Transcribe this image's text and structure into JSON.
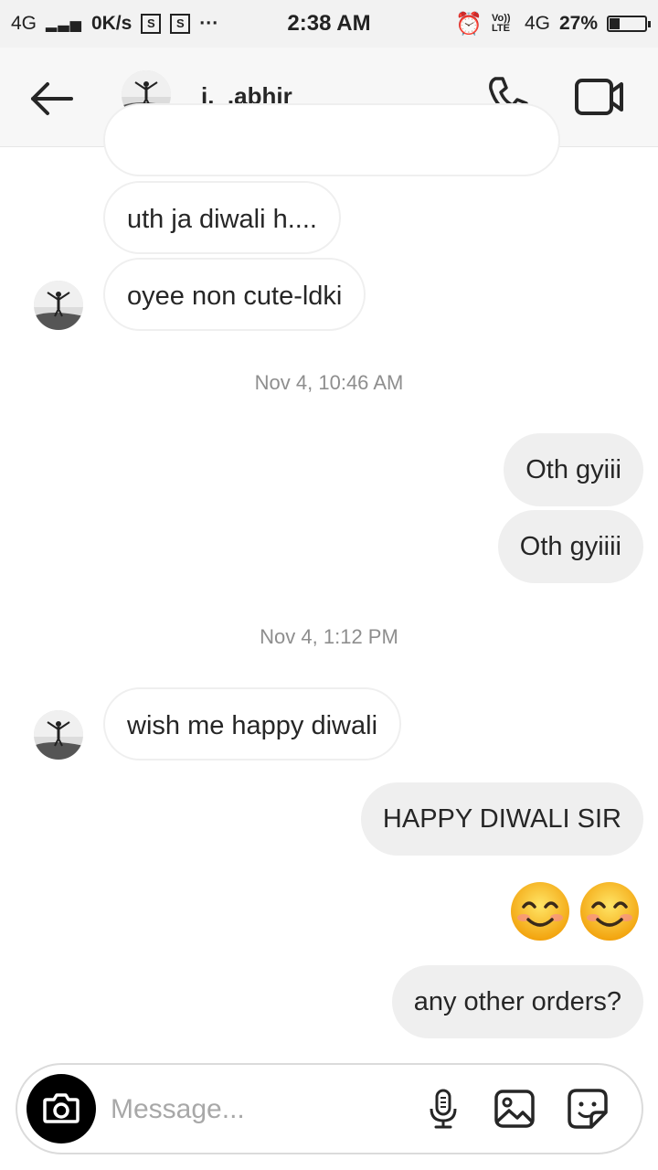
{
  "status_bar": {
    "network": "4G",
    "speed": "0K/s",
    "more": "···",
    "time": "2:38 AM",
    "volte": "Vo)) LTE",
    "net_right": "4G",
    "battery": "27%",
    "battery_level": 0.27
  },
  "header": {
    "username": "i._.abhir"
  },
  "messages": [
    {
      "kind": "in",
      "text": "uth ja diwali h...."
    },
    {
      "kind": "in",
      "text": "oyee non cute-ldki"
    },
    {
      "kind": "timestamp",
      "text": "Nov 4, 10:46 AM"
    },
    {
      "kind": "out",
      "text": "Oth gyiii"
    },
    {
      "kind": "out",
      "text": "Oth gyiiii"
    },
    {
      "kind": "timestamp",
      "text": "Nov 4, 1:12 PM"
    },
    {
      "kind": "in",
      "text": "wish me happy diwali"
    },
    {
      "kind": "out",
      "text": "HAPPY DIWALI SIR"
    },
    {
      "kind": "out-emoji",
      "emoji": [
        "smiling-face-icon",
        "smiling-face-icon"
      ]
    },
    {
      "kind": "out",
      "text": "any other orders?"
    }
  ],
  "composer": {
    "placeholder": "Message..."
  },
  "colors": {
    "incoming_border": "#efefef",
    "outgoing_bg": "#efefef",
    "timestamp": "#8e8e8e",
    "text": "#262626"
  }
}
